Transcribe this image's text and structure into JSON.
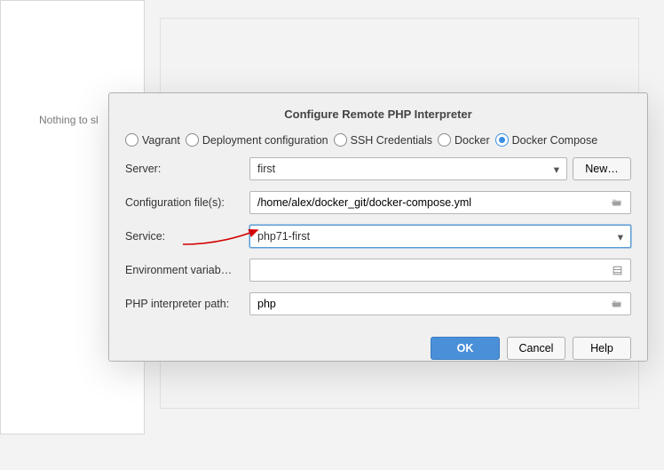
{
  "bg": {
    "nothing_label": "Nothing to sl"
  },
  "dialog": {
    "title": "Configure Remote PHP Interpreter",
    "radios": {
      "vagrant": "Vagrant",
      "deployment": "Deployment configuration",
      "ssh": "SSH Credentials",
      "docker": "Docker",
      "docker_compose": "Docker Compose"
    },
    "labels": {
      "server": "Server:",
      "config_files": "Configuration file(s):",
      "service": "Service:",
      "env": "Environment variab…",
      "interpreter_path": "PHP interpreter path:"
    },
    "values": {
      "server": "first",
      "config_files": "/home/alex/docker_git/docker-compose.yml",
      "service": "php71-first",
      "env": "",
      "interpreter_path": "php"
    },
    "buttons": {
      "new": "New…",
      "ok": "OK",
      "cancel": "Cancel",
      "help": "Help"
    }
  }
}
